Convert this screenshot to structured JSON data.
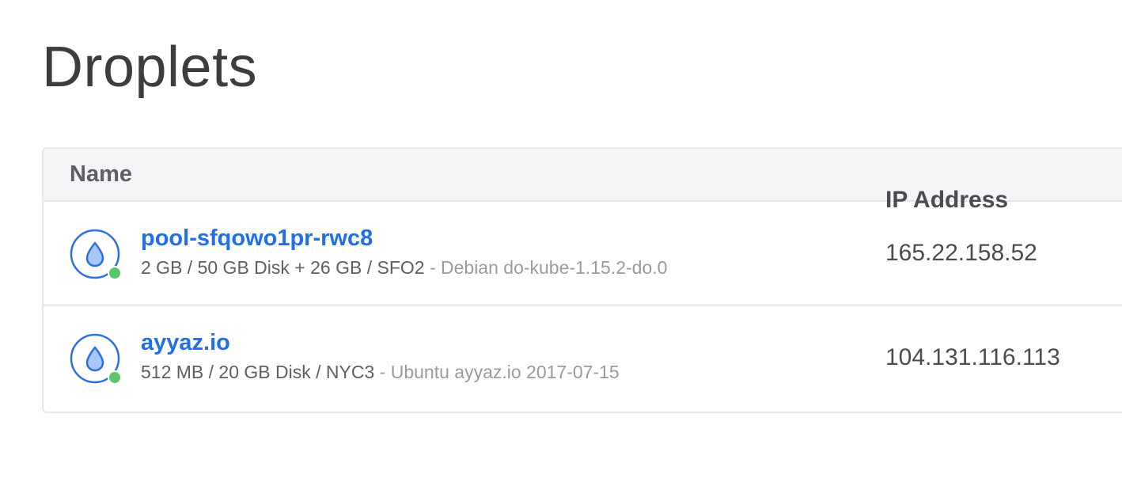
{
  "page": {
    "title": "Droplets"
  },
  "table": {
    "headers": {
      "name": "Name",
      "ip": "IP Address"
    },
    "rows": [
      {
        "name": "pool-sfqowo1pr-rwc8",
        "specs": "2 GB / 50 GB Disk + 26 GB / SFO2",
        "image": " - Debian do-kube-1.15.2-do.0",
        "ip": "165.22.158.52",
        "status": "active",
        "icon": "droplet-icon"
      },
      {
        "name": "ayyaz.io",
        "specs": "512 MB / 20 GB Disk / NYC3",
        "image": " - Ubuntu ayyaz.io 2017-07-15",
        "ip": "104.131.116.113",
        "status": "active",
        "icon": "droplet-icon"
      }
    ]
  },
  "colors": {
    "link": "#1f6eea",
    "status_active": "#59c768",
    "icon_stroke": "#2c6fe0",
    "icon_fill": "#a7c8f7"
  }
}
